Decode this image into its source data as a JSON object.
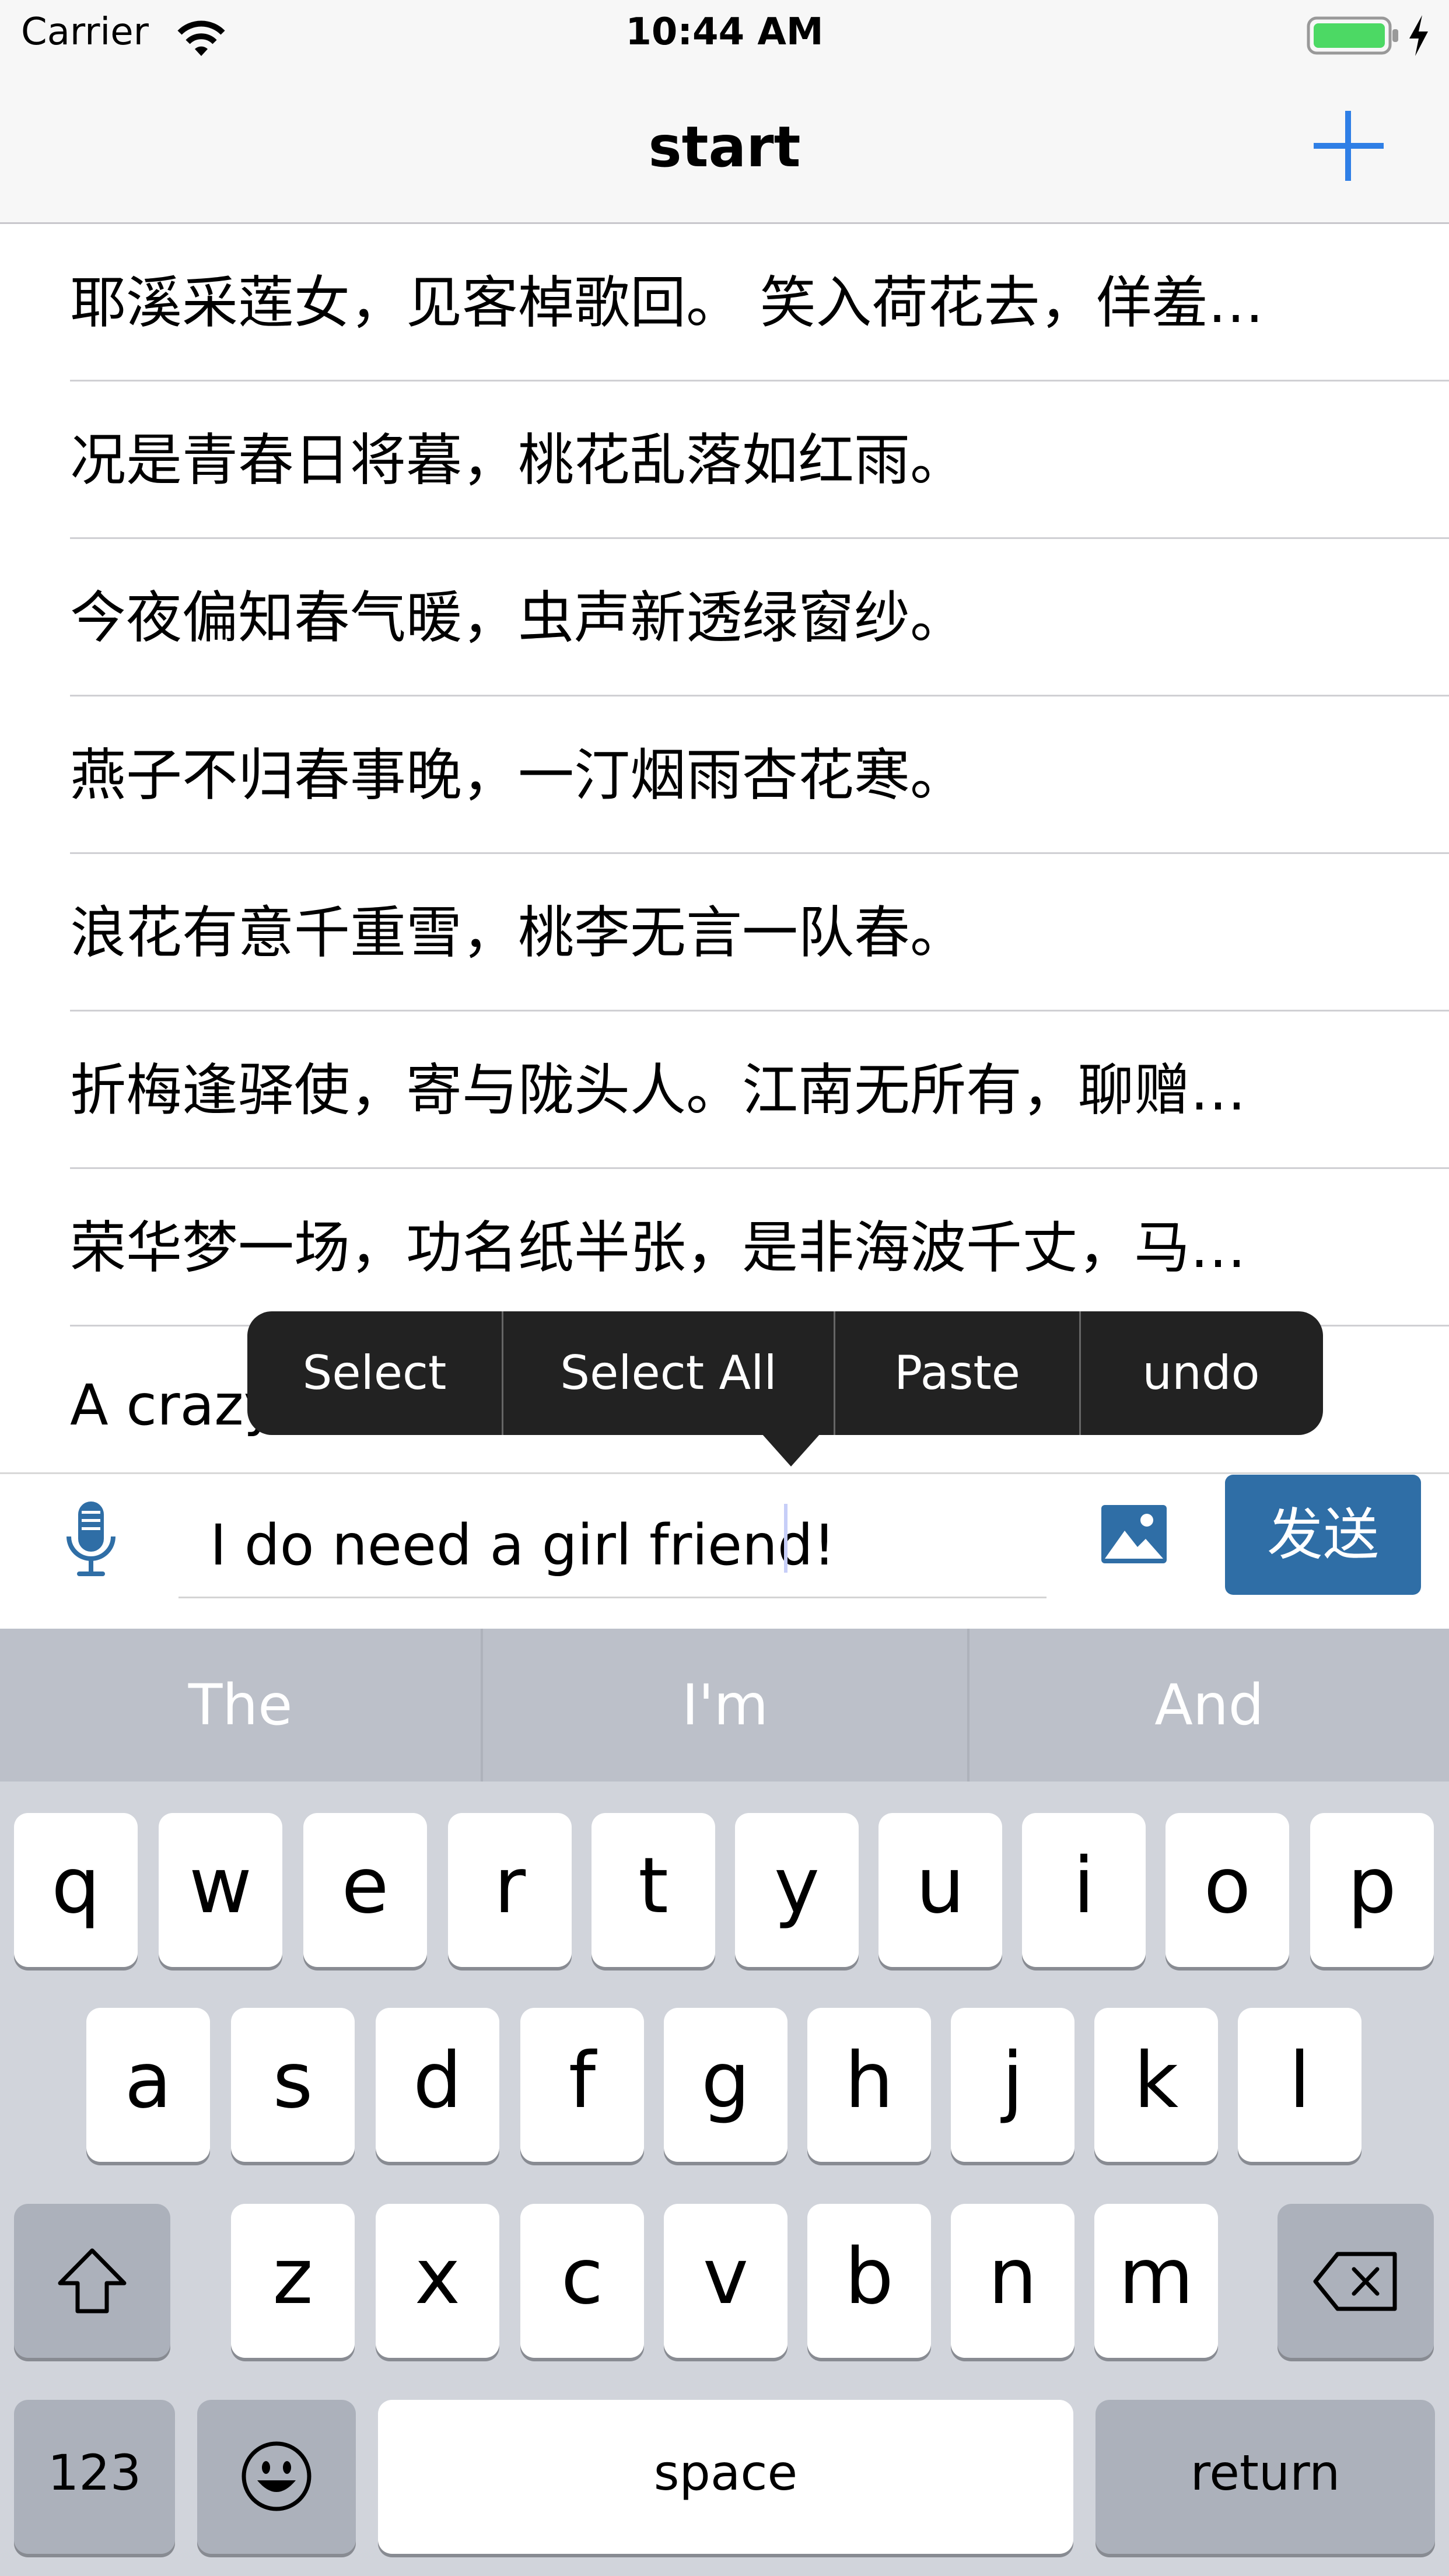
{
  "status_bar": {
    "carrier": "Carrier",
    "time": "10:44 AM",
    "battery_color": "#4cd964"
  },
  "nav": {
    "title": "start",
    "add_icon": "plus-icon",
    "accent": "#2f7fe6"
  },
  "messages": [
    "耶溪采莲女，见客棹歌回。 笑入荷花去，佯羞…",
    "况是青春日将暮，桃花乱落如红雨。",
    "今夜偏知春气暖，虫声新透绿窗纱。",
    "燕子不归春事晚，一汀烟雨杏花寒。",
    "浪花有意千重雪，桃李无言一队春。",
    "折梅逢驿使，寄与陇头人。江南无所有，聊赠…",
    "荣华梦一场，功名纸半张，是非海波千丈，马…",
    "A crazy"
  ],
  "edit_menu": {
    "items": [
      "Select",
      "Select All",
      "Paste",
      "undo"
    ]
  },
  "input_bar": {
    "mic_icon": "microphone-icon",
    "text": "I do need a girl friend!",
    "image_icon": "image-icon",
    "send_label": "发送",
    "send_color": "#2f6ea6"
  },
  "keyboard": {
    "suggestions": [
      "The",
      "I'm",
      "And"
    ],
    "row1": [
      "q",
      "w",
      "e",
      "r",
      "t",
      "y",
      "u",
      "i",
      "o",
      "p"
    ],
    "row2": [
      "a",
      "s",
      "d",
      "f",
      "g",
      "h",
      "j",
      "k",
      "l"
    ],
    "row3": [
      "z",
      "x",
      "c",
      "v",
      "b",
      "n",
      "m"
    ],
    "numbers_label": "123",
    "space_label": "space",
    "return_label": "return",
    "shift_icon": "shift-icon",
    "delete_icon": "delete-icon",
    "emoji_icon": "emoji-icon"
  }
}
